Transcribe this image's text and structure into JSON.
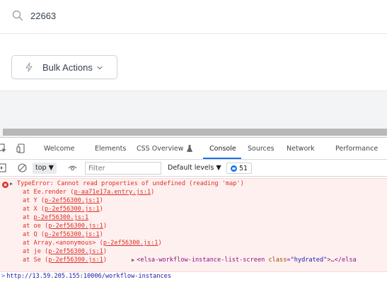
{
  "search": {
    "value": "22663"
  },
  "bulk_actions": {
    "label": "Bulk Actions"
  },
  "devtools": {
    "tabs": [
      "Welcome",
      "Elements",
      "CSS Overview",
      "Console",
      "Sources",
      "Network",
      "Performance"
    ],
    "active_tab": "Console",
    "toolbar": {
      "context": "top",
      "filter_placeholder": "Filter",
      "levels": "Default levels",
      "issues_count": "51"
    },
    "console": {
      "error_message": "TypeError: Cannot read properties of undefined (reading 'map')",
      "stack": [
        {
          "fn": "at Ee.render (",
          "file": "p-aa71e17a.entry.js:1",
          "close": ")"
        },
        {
          "fn": "at Y (",
          "file": "p-2ef56300.js:1",
          "close": ")"
        },
        {
          "fn": "at X (",
          "file": "p-2ef56300.js:1",
          "close": ")"
        },
        {
          "fn": "at ",
          "file": "p-2ef56300.js:1",
          "close": ""
        },
        {
          "fn": "at oe (",
          "file": "p-2ef56300.js:1",
          "close": ")"
        },
        {
          "fn": "at Q (",
          "file": "p-2ef56300.js:1",
          "close": ")"
        },
        {
          "fn": "at Array.<anonymous> (",
          "file": "p-2ef56300.js:1",
          "close": ")"
        },
        {
          "fn": "at je (",
          "file": "p-2ef56300.js:1",
          "close": ")"
        },
        {
          "fn": "at Se (",
          "file": "p-2ef56300.js:1",
          "close": ")"
        }
      ],
      "element_ref": {
        "open": "<elsa-workflow-instance-list-screen",
        "attr": "class",
        "val": "\"hydrated\"",
        "close": ">…</elsa"
      },
      "url": "http://13.59.205.155:10006/workflow-instances"
    }
  },
  "colors": {
    "error_text": "#d93025",
    "error_bg": "#fff0f0",
    "accent": "#1a73e8"
  }
}
